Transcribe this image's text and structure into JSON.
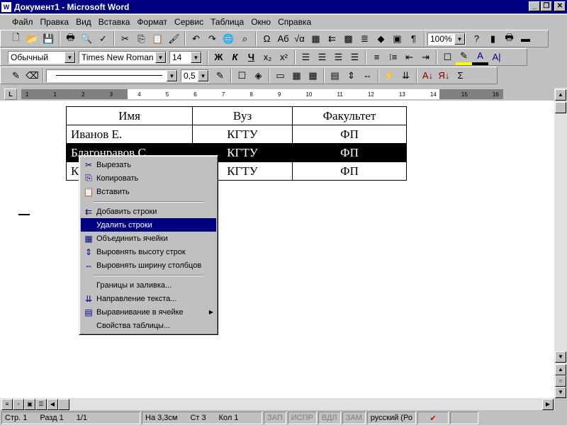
{
  "window": {
    "title": "Документ1 - Microsoft Word",
    "app_icon": "W",
    "minimize": "_",
    "restore": "❐",
    "close": "✕"
  },
  "menu": [
    "Файл",
    "Правка",
    "Вид",
    "Вставка",
    "Формат",
    "Сервис",
    "Таблица",
    "Окно",
    "Справка"
  ],
  "standard_toolbar": {
    "icons": [
      "new-icon",
      "open-icon",
      "save-icon",
      "print-icon",
      "preview-icon",
      "spelling-icon",
      "cut-icon",
      "copy-icon",
      "paste-icon",
      "format-painter-icon",
      "undo-icon",
      "redo-icon",
      "hyperlink-icon",
      "find-icon",
      "symbol-icon",
      "case-icon",
      "equation-icon",
      "draw-table-icon",
      "insert-rows-icon",
      "excel-icon",
      "columns-icon",
      "drawing-icon",
      "map-icon",
      "pilcrow-icon",
      "help-icon",
      "chart-icon",
      "print2-icon",
      "folder-icon"
    ],
    "zoom": "100%"
  },
  "formatting_toolbar": {
    "style": "Обычный",
    "font": "Times New Roman",
    "size": "14",
    "bold": "Ж",
    "italic": "К",
    "underline": "Ч",
    "highlight_color": "#ffff00",
    "font_color": "#000000"
  },
  "tables_toolbar": {
    "line_weight": "0,5"
  },
  "ruler": {
    "ticks": [
      "1",
      "1",
      "2",
      "3",
      "4",
      "5",
      "6",
      "7",
      "8",
      "9",
      "10",
      "11",
      "12",
      "13",
      "14",
      "15",
      "16"
    ]
  },
  "table": {
    "header": [
      "Имя",
      "Вуз",
      "Факультет"
    ],
    "rows": [
      [
        "Иванов Е.",
        "КГТУ",
        "ФП"
      ],
      [
        "Благонравов С.",
        "КГТУ",
        "ФП"
      ],
      [
        "К",
        "КГТУ",
        "ФП"
      ]
    ],
    "selected_row": 1
  },
  "context_menu": {
    "items": [
      {
        "label": "Вырезать",
        "icon": "✂"
      },
      {
        "label": "Копировать",
        "icon": "⎘"
      },
      {
        "label": "Вставить",
        "icon": "📋"
      },
      {
        "sep": true
      },
      {
        "label": "Добавить строки",
        "icon": "⇇"
      },
      {
        "label": "Удалить строки",
        "icon": "",
        "highlighted": true
      },
      {
        "label": "Объединить ячейки",
        "icon": "▦"
      },
      {
        "label": "Выровнять высоту строк",
        "icon": "⇕"
      },
      {
        "label": "Выровнять ширину столбцов",
        "icon": "⇔"
      },
      {
        "sep": true
      },
      {
        "label": "Границы и заливка...",
        "icon": ""
      },
      {
        "label": "Направление текста...",
        "icon": "⇊"
      },
      {
        "label": "Выравнивание в ячейке",
        "icon": "▤",
        "submenu": true
      },
      {
        "label": "Свойства таблицы...",
        "icon": ""
      }
    ]
  },
  "status": {
    "page": "Стр. 1",
    "section": "Разд 1",
    "pages": "1/1",
    "at": "На 3,3см",
    "line": "Ст 3",
    "col": "Кол 1",
    "rec": "ЗАП",
    "trk": "ИСПР",
    "ext": "ВДЛ",
    "ovr": "ЗАМ",
    "lang": "русский (Ро"
  }
}
